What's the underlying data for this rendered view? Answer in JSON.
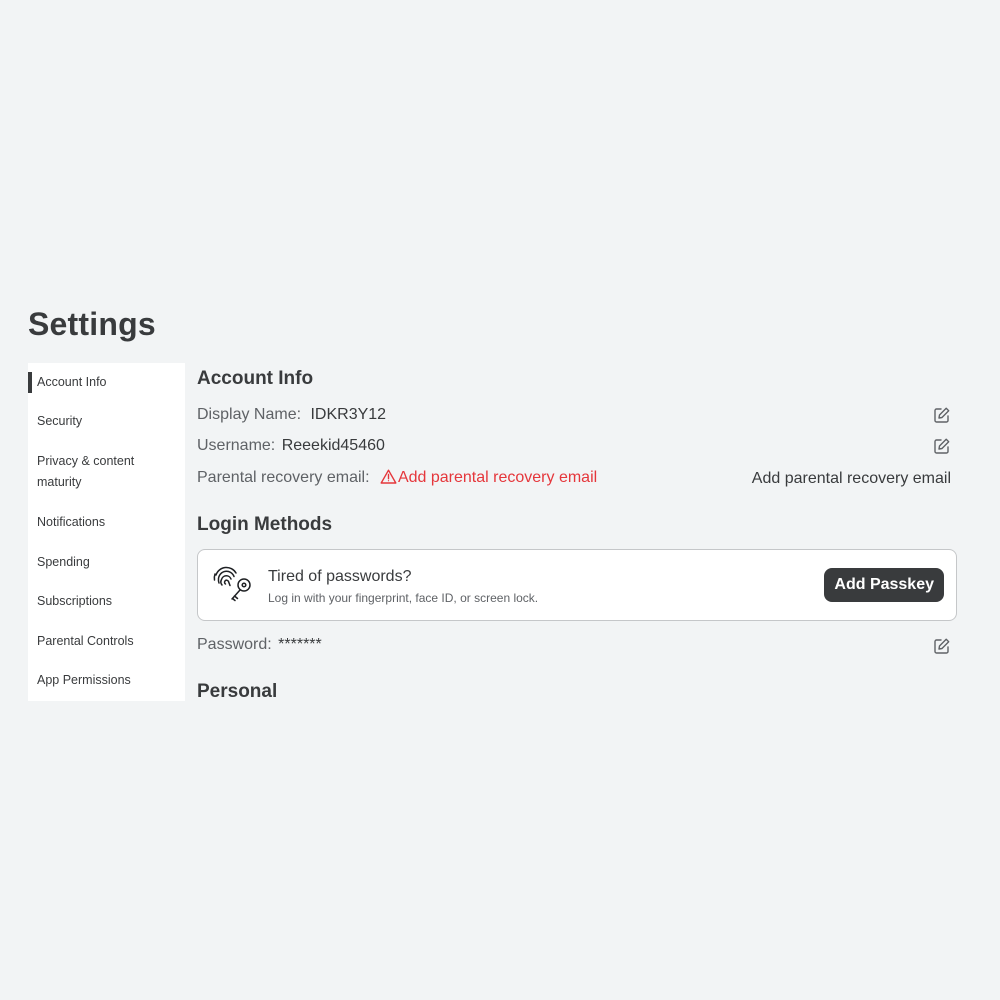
{
  "page": {
    "title": "Settings"
  },
  "sidebar": {
    "items": [
      {
        "label": "Account Info",
        "active": true
      },
      {
        "label": "Security"
      },
      {
        "label": "Privacy & content maturity"
      },
      {
        "label": "Notifications"
      },
      {
        "label": "Spending"
      },
      {
        "label": "Subscriptions"
      },
      {
        "label": "Parental Controls"
      },
      {
        "label": "App Permissions"
      }
    ]
  },
  "account_info": {
    "title": "Account Info",
    "display_name_label": "Display Name:",
    "display_name_value": "IDKR3Y12",
    "username_label": "Username:",
    "username_value": "Reeekid45460",
    "parental_email_label": "Parental recovery email:",
    "parental_email_warning": "Add parental recovery email",
    "parental_email_action": "Add parental recovery email"
  },
  "login_methods": {
    "title": "Login Methods",
    "passkey_title": "Tired of passwords?",
    "passkey_subtitle": "Log in with your fingerprint, face ID, or screen lock.",
    "passkey_button": "Add Passkey",
    "password_label": "Password:",
    "password_value": "*******"
  },
  "personal": {
    "title": "Personal"
  },
  "icons": {
    "edit": "edit-pencil-icon",
    "warning": "warning-triangle-icon",
    "passkey": "fingerprint-key-icon"
  },
  "colors": {
    "background": "#f2f4f5",
    "text": "#393b3d",
    "warning": "#e5363b",
    "button_bg": "#393b3d"
  }
}
